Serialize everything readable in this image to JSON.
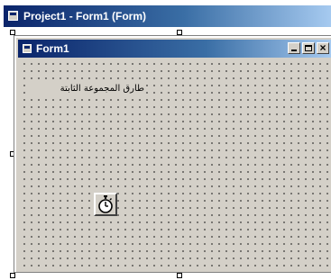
{
  "outer_window": {
    "title": "Project1 - Form1 (Form)"
  },
  "form": {
    "title": "Form1",
    "label_text": "طارق المجموعة الثابتة",
    "caption_buttons": [
      "minimize",
      "maximize",
      "close"
    ]
  },
  "icons": {
    "outer_app_icon": "form-icon",
    "form_icon": "form-icon",
    "timer_icon": "stopwatch-icon"
  },
  "colors": {
    "titlebar_start": "#0a246a",
    "titlebar_end": "#a6caf0",
    "form_face": "#d4d0c8"
  }
}
